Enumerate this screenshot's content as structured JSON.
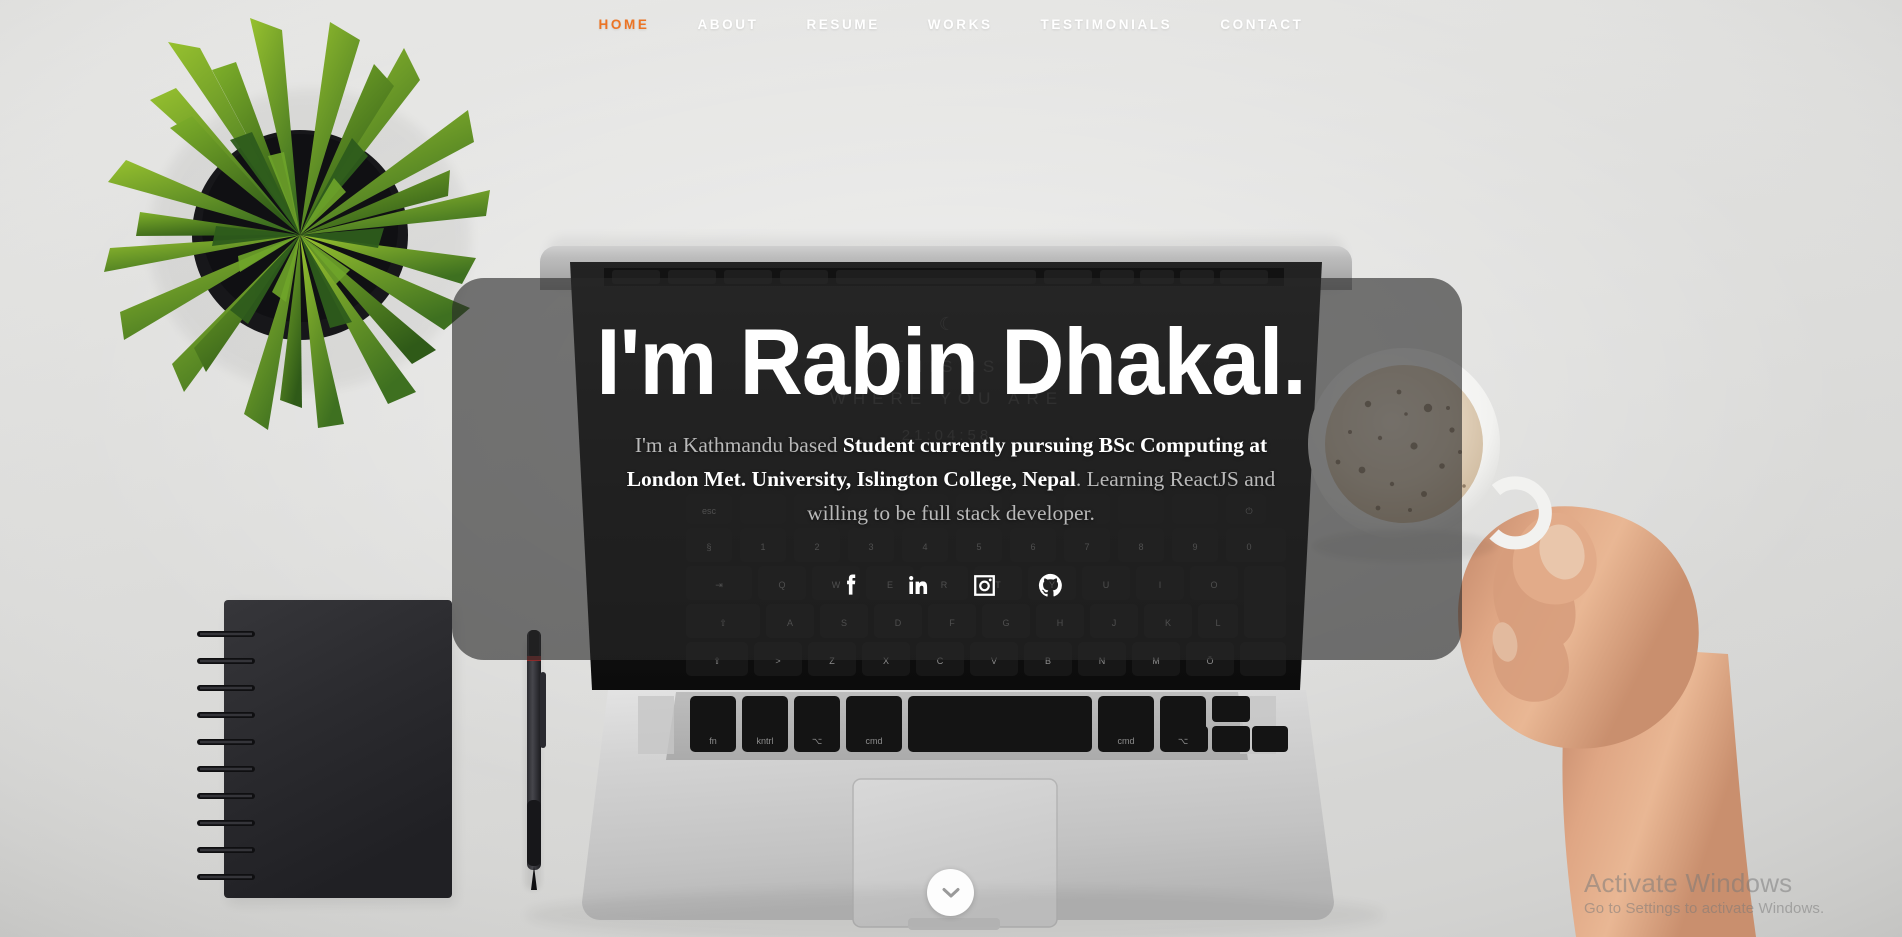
{
  "site": {
    "background_color": "#dededc",
    "accent_color": "#ec7424",
    "card_color": "rgba(40,40,40,0.62)"
  },
  "nav": {
    "items": [
      {
        "label": "HOME",
        "active": true,
        "name": "nav-link-home"
      },
      {
        "label": "ABOUT",
        "active": false,
        "name": "nav-link-about"
      },
      {
        "label": "RESUME",
        "active": false,
        "name": "nav-link-resume"
      },
      {
        "label": "WORKS",
        "active": false,
        "name": "nav-link-works"
      },
      {
        "label": "TESTIMONIALS",
        "active": false,
        "name": "nav-link-testimonials"
      },
      {
        "label": "CONTACT",
        "active": false,
        "name": "nav-link-contact"
      }
    ]
  },
  "hero": {
    "title": "I'm Rabin Dhakal.",
    "subtitle_parts": [
      {
        "text": "I'm a Kathmandu based ",
        "emphasis": false
      },
      {
        "text": "Student currently pursuing BSc Computing at London Met. University, Islington College, Nepal",
        "emphasis": true
      },
      {
        "text": ". Learning ReactJS and willing to be full stack developer.",
        "emphasis": false
      }
    ],
    "subtitle_plain": "I'm a Kathmandu based Student currently pursuing BSc Computing at London Met. University, Islington College, Nepal. Learning ReactJS and willing to be full stack developer.",
    "socials": [
      {
        "label": "Facebook",
        "icon": "facebook-icon"
      },
      {
        "label": "LinkedIn",
        "icon": "linkedin-icon"
      },
      {
        "label": "Instagram",
        "icon": "instagram-icon"
      },
      {
        "label": "GitHub",
        "icon": "github-icon"
      }
    ],
    "scroll_down_label": "Scroll down"
  },
  "watermark": {
    "title": "Activate Windows",
    "subtitle": "Go to Settings to activate Windows."
  }
}
